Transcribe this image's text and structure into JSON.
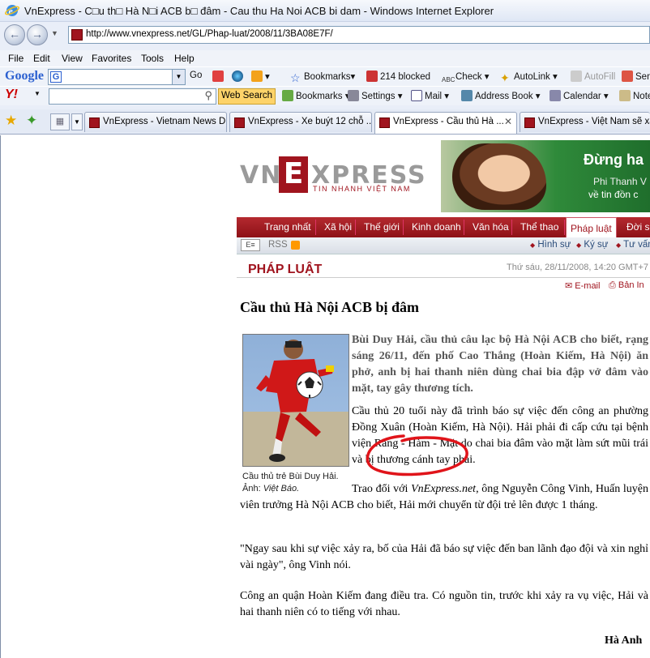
{
  "window": {
    "title": "VnExpress - C□u th□ Hà N□i ACB b□ đâm - Cau thu Ha Noi ACB bi dam - Windows Internet Explorer"
  },
  "address": {
    "url": "http://www.vnexpress.net/GL/Phap-luat/2008/11/3BA08E7F/"
  },
  "menu": [
    "File",
    "Edit",
    "View",
    "Favorites",
    "Tools",
    "Help"
  ],
  "google_toolbar": {
    "logo": "Google",
    "go": "Go",
    "bookmarks": "Bookmarks▾",
    "blocked": "214 blocked",
    "check": "Check",
    "autolink": "AutoLink",
    "autofill": "AutoFill",
    "send": "Sen"
  },
  "yahoo_toolbar": {
    "logo": "Y!",
    "web_search": "Web Search",
    "bookmarks": "Bookmarks",
    "settings": "Settings",
    "mail": "Mail",
    "address_book": "Address Book",
    "calendar": "Calendar",
    "notepad": "Note"
  },
  "tabs": [
    {
      "label": "VnExpress - Vietnam News D..."
    },
    {
      "label": "VnExpress - Xe buýt 12 chỗ ..."
    },
    {
      "label": "VnExpress - Cầu thủ Hà ..."
    },
    {
      "label": "VnExpress - Việt Nam sẽ xây"
    }
  ],
  "site": {
    "logo_left": "VN",
    "logo_right": "XPRESS",
    "logo_letter": "E",
    "tagline": "TIN NHANH VIỆT NAM"
  },
  "banner": {
    "line1": "Đừng ha",
    "line2": "Phi Thanh V",
    "line3": "về tin đồn c"
  },
  "nav": [
    "Trang nhất",
    "Xã hội",
    "Thế giới",
    "Kinh doanh",
    "Văn hóa",
    "Thể thao",
    "Pháp luật",
    "Đời số"
  ],
  "subnav": {
    "rss": "RSS",
    "items": [
      "Hình sự",
      "Ký sự",
      "Tư vấn"
    ]
  },
  "section": {
    "title": "PHÁP LUẬT",
    "date": "Thứ sáu, 28/11/2008, 14:20 GMT+7",
    "email": "E-mail",
    "print": "Bản In"
  },
  "article": {
    "headline": "Cầu thủ Hà Nội ACB bị đâm",
    "lead": "Bùi Duy Hải, cầu thủ câu lạc bộ Hà Nội ACB cho biết, rạng sáng 26/11, đến phố Cao Thắng (Hoàn Kiếm, Hà Nội) ăn phở, anh bị hai thanh niên dùng chai bia đập vở đâm vào mặt, tay gây thương tích.",
    "p1": "Cầu thủ 20 tuổi này đã trình báo sự việc đến công an phường Đồng Xuân (Hoàn Kiếm, Hà Nội). Hải phải đi cấp cứu tại bệnh viện Răng - Hàm - Mặt do chai bia đâm vào mặt làm sứt mũi trái và bị thương cánh tay phải.",
    "p2_pre": "Trao đổi với ",
    "p2_source": "VnExpress.net",
    "p2_post": ", ông Nguyễn Công Vinh, Huấn luyện viên trưởng Hà Nội ACB cho biết, Hải mới chuyển từ đội trẻ lên được 1 tháng.",
    "p3": "\"Ngay sau khi sự việc xảy ra, bố của Hải đã báo sự việc đến ban lãnh đạo đội và xin nghỉ vài ngày\", ông Vinh nói.",
    "p4": "Công an quận Hoàn Kiếm đang điều tra. Có nguồn tin, trước khi xảy ra vụ việc, Hải và hai thanh niên có to tiếng với nhau.",
    "author": "Hà Anh",
    "caption_line1": "Cầu thủ trẻ Bùi Duy Hải.",
    "caption_prefix": "Ảnh: ",
    "caption_source": "Việt Báo."
  }
}
